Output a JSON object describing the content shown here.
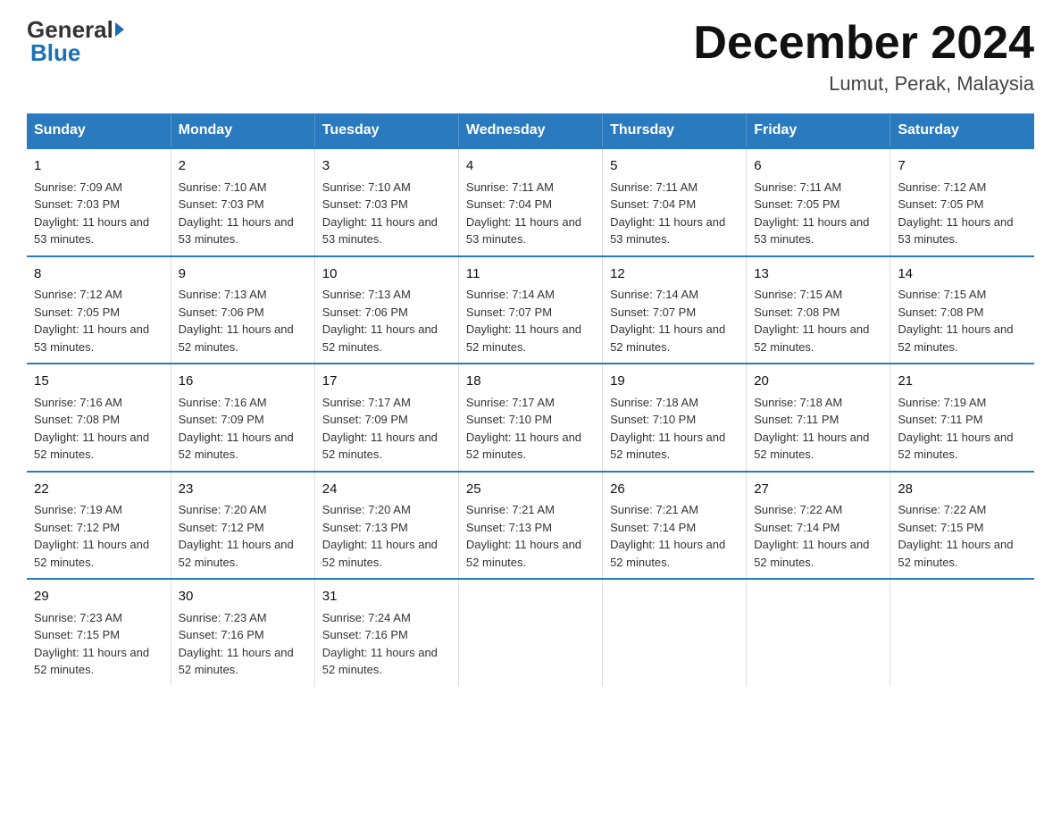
{
  "logo": {
    "general": "General",
    "arrow": "▶",
    "blue": "Blue"
  },
  "title": "December 2024",
  "subtitle": "Lumut, Perak, Malaysia",
  "days_of_week": [
    "Sunday",
    "Monday",
    "Tuesday",
    "Wednesday",
    "Thursday",
    "Friday",
    "Saturday"
  ],
  "weeks": [
    [
      {
        "day": "1",
        "sunrise": "7:09 AM",
        "sunset": "7:03 PM",
        "daylight": "11 hours and 53 minutes."
      },
      {
        "day": "2",
        "sunrise": "7:10 AM",
        "sunset": "7:03 PM",
        "daylight": "11 hours and 53 minutes."
      },
      {
        "day": "3",
        "sunrise": "7:10 AM",
        "sunset": "7:03 PM",
        "daylight": "11 hours and 53 minutes."
      },
      {
        "day": "4",
        "sunrise": "7:11 AM",
        "sunset": "7:04 PM",
        "daylight": "11 hours and 53 minutes."
      },
      {
        "day": "5",
        "sunrise": "7:11 AM",
        "sunset": "7:04 PM",
        "daylight": "11 hours and 53 minutes."
      },
      {
        "day": "6",
        "sunrise": "7:11 AM",
        "sunset": "7:05 PM",
        "daylight": "11 hours and 53 minutes."
      },
      {
        "day": "7",
        "sunrise": "7:12 AM",
        "sunset": "7:05 PM",
        "daylight": "11 hours and 53 minutes."
      }
    ],
    [
      {
        "day": "8",
        "sunrise": "7:12 AM",
        "sunset": "7:05 PM",
        "daylight": "11 hours and 53 minutes."
      },
      {
        "day": "9",
        "sunrise": "7:13 AM",
        "sunset": "7:06 PM",
        "daylight": "11 hours and 52 minutes."
      },
      {
        "day": "10",
        "sunrise": "7:13 AM",
        "sunset": "7:06 PM",
        "daylight": "11 hours and 52 minutes."
      },
      {
        "day": "11",
        "sunrise": "7:14 AM",
        "sunset": "7:07 PM",
        "daylight": "11 hours and 52 minutes."
      },
      {
        "day": "12",
        "sunrise": "7:14 AM",
        "sunset": "7:07 PM",
        "daylight": "11 hours and 52 minutes."
      },
      {
        "day": "13",
        "sunrise": "7:15 AM",
        "sunset": "7:08 PM",
        "daylight": "11 hours and 52 minutes."
      },
      {
        "day": "14",
        "sunrise": "7:15 AM",
        "sunset": "7:08 PM",
        "daylight": "11 hours and 52 minutes."
      }
    ],
    [
      {
        "day": "15",
        "sunrise": "7:16 AM",
        "sunset": "7:08 PM",
        "daylight": "11 hours and 52 minutes."
      },
      {
        "day": "16",
        "sunrise": "7:16 AM",
        "sunset": "7:09 PM",
        "daylight": "11 hours and 52 minutes."
      },
      {
        "day": "17",
        "sunrise": "7:17 AM",
        "sunset": "7:09 PM",
        "daylight": "11 hours and 52 minutes."
      },
      {
        "day": "18",
        "sunrise": "7:17 AM",
        "sunset": "7:10 PM",
        "daylight": "11 hours and 52 minutes."
      },
      {
        "day": "19",
        "sunrise": "7:18 AM",
        "sunset": "7:10 PM",
        "daylight": "11 hours and 52 minutes."
      },
      {
        "day": "20",
        "sunrise": "7:18 AM",
        "sunset": "7:11 PM",
        "daylight": "11 hours and 52 minutes."
      },
      {
        "day": "21",
        "sunrise": "7:19 AM",
        "sunset": "7:11 PM",
        "daylight": "11 hours and 52 minutes."
      }
    ],
    [
      {
        "day": "22",
        "sunrise": "7:19 AM",
        "sunset": "7:12 PM",
        "daylight": "11 hours and 52 minutes."
      },
      {
        "day": "23",
        "sunrise": "7:20 AM",
        "sunset": "7:12 PM",
        "daylight": "11 hours and 52 minutes."
      },
      {
        "day": "24",
        "sunrise": "7:20 AM",
        "sunset": "7:13 PM",
        "daylight": "11 hours and 52 minutes."
      },
      {
        "day": "25",
        "sunrise": "7:21 AM",
        "sunset": "7:13 PM",
        "daylight": "11 hours and 52 minutes."
      },
      {
        "day": "26",
        "sunrise": "7:21 AM",
        "sunset": "7:14 PM",
        "daylight": "11 hours and 52 minutes."
      },
      {
        "day": "27",
        "sunrise": "7:22 AM",
        "sunset": "7:14 PM",
        "daylight": "11 hours and 52 minutes."
      },
      {
        "day": "28",
        "sunrise": "7:22 AM",
        "sunset": "7:15 PM",
        "daylight": "11 hours and 52 minutes."
      }
    ],
    [
      {
        "day": "29",
        "sunrise": "7:23 AM",
        "sunset": "7:15 PM",
        "daylight": "11 hours and 52 minutes."
      },
      {
        "day": "30",
        "sunrise": "7:23 AM",
        "sunset": "7:16 PM",
        "daylight": "11 hours and 52 minutes."
      },
      {
        "day": "31",
        "sunrise": "7:24 AM",
        "sunset": "7:16 PM",
        "daylight": "11 hours and 52 minutes."
      },
      {
        "day": "",
        "sunrise": "",
        "sunset": "",
        "daylight": ""
      },
      {
        "day": "",
        "sunrise": "",
        "sunset": "",
        "daylight": ""
      },
      {
        "day": "",
        "sunrise": "",
        "sunset": "",
        "daylight": ""
      },
      {
        "day": "",
        "sunrise": "",
        "sunset": "",
        "daylight": ""
      }
    ]
  ]
}
